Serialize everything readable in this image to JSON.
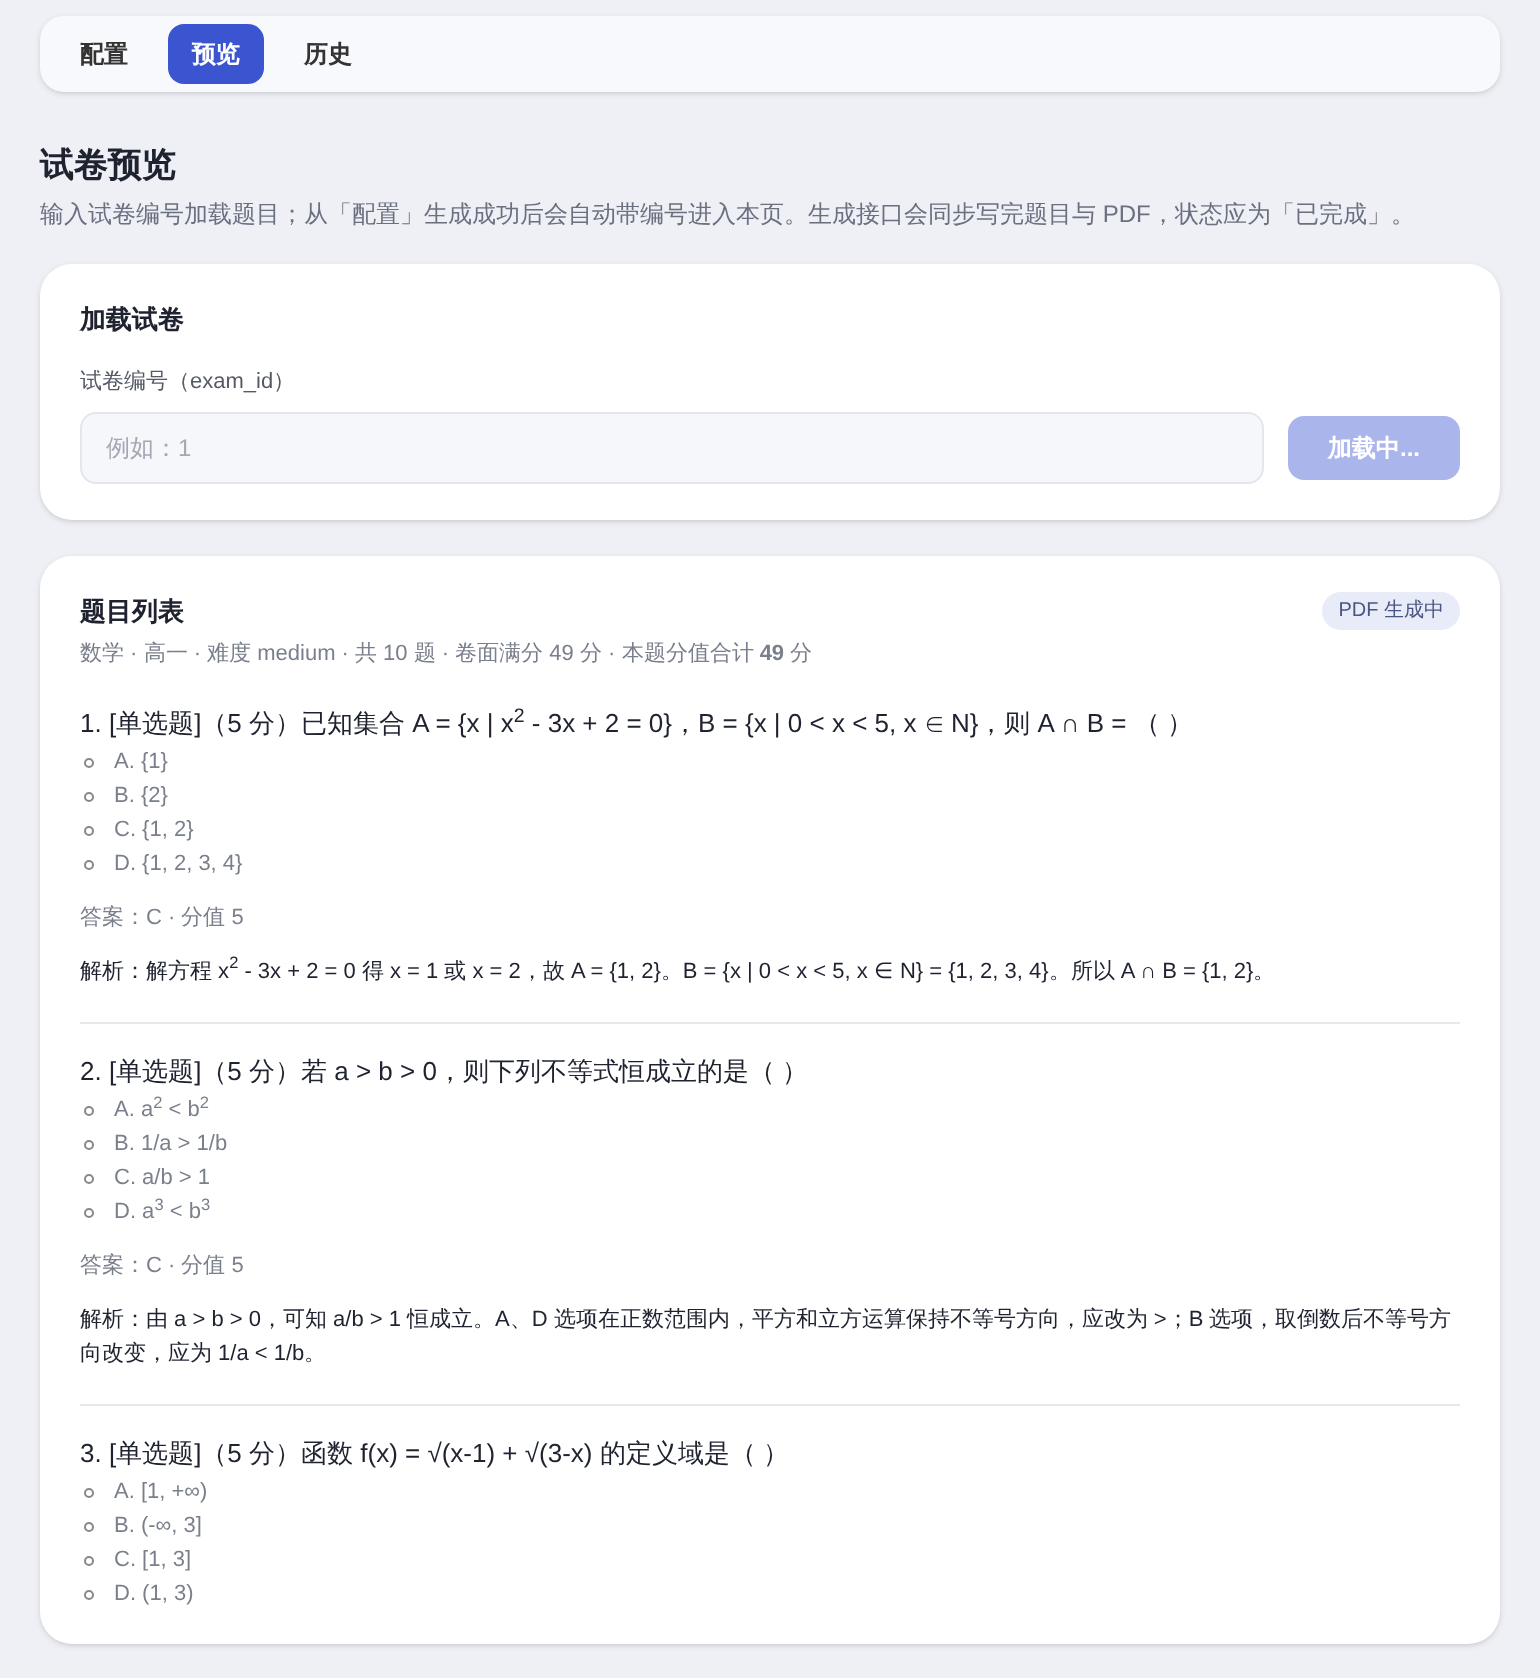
{
  "tabs": [
    {
      "label": "配置",
      "selected": false
    },
    {
      "label": "预览",
      "selected": true
    },
    {
      "label": "历史",
      "selected": false
    }
  ],
  "page": {
    "title": "试卷预览",
    "description": "输入试卷编号加载题目；从「配置」生成成功后会自动带编号进入本页。生成接口会同步写完题目与 PDF，状态应为「已完成」。"
  },
  "load_card": {
    "title": "加载试卷",
    "field_label": "试卷编号（exam_id）",
    "placeholder": "例如：1",
    "button": {
      "label": "加载中...",
      "disabled": true
    }
  },
  "question_list": {
    "title": "题目列表",
    "status_badge": "PDF 生成中",
    "meta": "数学 · 高一 · 难度 medium · 共 10 题 · 卷面满分 49 分 · 本题分值合计 **49** 分",
    "questions": [
      {
        "title": "1. [单选题]（5 分）已知集合 A = {x | x$^{2}$ - 3x + 2 = 0}，B = {x | 0 < x < 5, x ∈ N}，则 A ∩ B = （ ）",
        "options": [
          "A. {1}",
          "B. {2}",
          "C. {1, 2}",
          "D. {1, 2, 3, 4}"
        ],
        "answer": "答案：C · 分值 5",
        "explanation": "解析：解方程 x$^{2}$ - 3x + 2 = 0 得 x = 1 或 x = 2，故 A = {1, 2}。B = {x | 0 < x < 5, x ∈ N} = {1, 2, 3, 4}。所以 A ∩ B = {1, 2}。"
      },
      {
        "title": "2. [单选题]（5 分）若 a > b > 0，则下列不等式恒成立的是（ ）",
        "options": [
          "A. a$^{2}$ < b$^{2}$",
          "B. 1/a > 1/b",
          "C. a/b > 1",
          "D. a$^{3}$ < b$^{3}$"
        ],
        "answer": "答案：C · 分值 5",
        "explanation": "解析：由 a > b > 0，可知 a/b > 1 恒成立。A、D 选项在正数范围内，平方和立方运算保持不等号方向，应改为 >；B 选项，取倒数后不等号方向改变，应为 1/a < 1/b。"
      },
      {
        "title": "3. [单选题]（5 分）函数 f(x) = √(x-1) + √(3-x) 的定义域是（ ）",
        "options": [
          "A. [1, +∞)",
          "B. (-∞, 3]",
          "C. [1, 3]",
          "D. (1, 3)"
        ]
      }
    ]
  }
}
